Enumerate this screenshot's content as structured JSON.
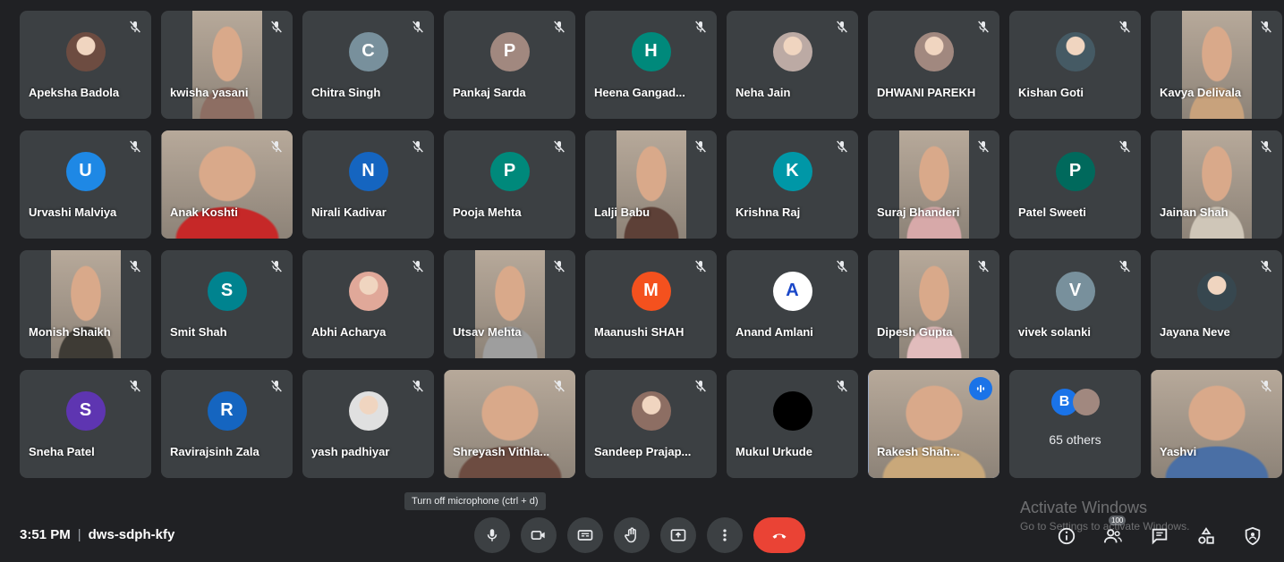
{
  "participants": [
    {
      "name": "Apeksha Badola",
      "kind": "photo",
      "color": "#6d4c41"
    },
    {
      "name": "kwisha yasani",
      "kind": "video",
      "color": "#8d6e63"
    },
    {
      "name": "Chitra Singh",
      "kind": "initial",
      "initial": "C",
      "color": "#78909c"
    },
    {
      "name": "Pankaj Sarda",
      "kind": "initial",
      "initial": "P",
      "color": "#a1887f"
    },
    {
      "name": "Heena Gangad...",
      "kind": "initial",
      "initial": "H",
      "color": "#00897b"
    },
    {
      "name": "Neha Jain",
      "kind": "photo",
      "color": "#bcaaa4"
    },
    {
      "name": "DHWANI PAREKH",
      "kind": "photo",
      "color": "#a1887f"
    },
    {
      "name": "Kishan Goti",
      "kind": "photo",
      "color": "#455a64"
    },
    {
      "name": "Kavya Delivala",
      "kind": "video",
      "color": "#c8a27c"
    },
    {
      "name": "Urvashi Malviya",
      "kind": "initial",
      "initial": "U",
      "color": "#1e88e5"
    },
    {
      "name": "Anak Koshti",
      "kind": "video",
      "color": "#c62828",
      "wide": true
    },
    {
      "name": "Nirali Kadivar",
      "kind": "initial",
      "initial": "N",
      "color": "#1565c0"
    },
    {
      "name": "Pooja Mehta",
      "kind": "initial",
      "initial": "P",
      "color": "#00897b"
    },
    {
      "name": "Lalji Babu",
      "kind": "video",
      "color": "#5d4037"
    },
    {
      "name": "Krishna Raj",
      "kind": "initial",
      "initial": "K",
      "color": "#0097a7"
    },
    {
      "name": "Suraj Bhanderi",
      "kind": "video",
      "color": "#d7a9a9"
    },
    {
      "name": "Patel Sweeti",
      "kind": "initial",
      "initial": "P",
      "color": "#00695c"
    },
    {
      "name": "Jainan Shah",
      "kind": "video",
      "color": "#cfc6b8"
    },
    {
      "name": "Monish Shaikh",
      "kind": "video",
      "color": "#3e3b35"
    },
    {
      "name": "Smit Shah",
      "kind": "initial",
      "initial": "S",
      "color": "#00838f"
    },
    {
      "name": "Abhi Acharya",
      "kind": "photo",
      "color": "#e0a899"
    },
    {
      "name": "Utsav Mehta",
      "kind": "video",
      "color": "#9e9e9e"
    },
    {
      "name": "Maanushi SHAH",
      "kind": "initial",
      "initial": "M",
      "color": "#f4511e"
    },
    {
      "name": "Anand Amlani",
      "kind": "initial",
      "initial": "A",
      "color": "#ffffff",
      "textColor": "#1a47c8"
    },
    {
      "name": "Dipesh Gupta",
      "kind": "video",
      "color": "#e1bcbc"
    },
    {
      "name": "vivek solanki",
      "kind": "initial",
      "initial": "V",
      "color": "#78909c"
    },
    {
      "name": "Jayana Neve",
      "kind": "photo",
      "color": "#37474f"
    },
    {
      "name": "Sneha Patel",
      "kind": "initial",
      "initial": "S",
      "color": "#5e35b1"
    },
    {
      "name": "Ravirajsinh Zala",
      "kind": "initial",
      "initial": "R",
      "color": "#1565c0"
    },
    {
      "name": "yash padhiyar",
      "kind": "photo",
      "color": "#e0e0e0"
    },
    {
      "name": "Shreyash Vithla...",
      "kind": "video",
      "color": "#6d4c41",
      "wide": true
    },
    {
      "name": "Sandeep Prajap...",
      "kind": "photo",
      "color": "#8d6e63"
    },
    {
      "name": "Mukul Urkude",
      "kind": "initial",
      "initial": "",
      "color": "#000000"
    },
    {
      "name": "Rakesh Shah...",
      "kind": "video",
      "color": "#c9a87a",
      "wide": true,
      "speaking": true
    },
    {
      "name": "",
      "kind": "others"
    },
    {
      "name": "Yashvi",
      "kind": "video",
      "color": "#4a6fa5",
      "wide": true
    }
  ],
  "others": {
    "initial": "B",
    "label": "65 others"
  },
  "meeting": {
    "time": "3:51 PM",
    "separator": "|",
    "code": "dws-sdph-kfy"
  },
  "tooltip": "Turn off microphone (ctrl + d)",
  "participants_count": "100",
  "watermark": {
    "title": "Activate Windows",
    "subtitle": "Go to Settings to activate Windows."
  },
  "icons": {
    "mute": "mic-off-icon",
    "mic": "mic-icon",
    "camera": "camera-icon",
    "captions": "captions-icon",
    "hand": "raise-hand-icon",
    "present": "present-icon",
    "more": "more-options-icon",
    "end": "end-call-icon",
    "info": "info-icon",
    "people": "people-icon",
    "chat": "chat-icon",
    "activities": "activities-icon",
    "host": "host-controls-icon"
  },
  "colors": {
    "background": "#202124",
    "tile": "#3c4043",
    "end_call": "#ea4335",
    "speaking_outline": "#8ab4f8"
  }
}
